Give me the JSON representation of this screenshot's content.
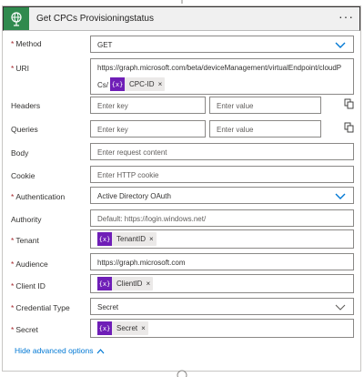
{
  "header": {
    "title": "Get CPCs Provisioningstatus",
    "menu_label": "···"
  },
  "fields": {
    "method": {
      "label": "Method",
      "required": true,
      "value": "GET"
    },
    "uri": {
      "label": "URI",
      "required": true,
      "value_line1": "https://graph.microsoft.com/beta/deviceManagement/virtualEndpoint/cloudP",
      "value_prefix": "Cs/",
      "token": "CPC-ID"
    },
    "headers": {
      "label": "Headers",
      "key_placeholder": "Enter key",
      "value_placeholder": "Enter value"
    },
    "queries": {
      "label": "Queries",
      "key_placeholder": "Enter key",
      "value_placeholder": "Enter value"
    },
    "body": {
      "label": "Body",
      "placeholder": "Enter request content"
    },
    "cookie": {
      "label": "Cookie",
      "placeholder": "Enter HTTP cookie"
    },
    "authentication": {
      "label": "Authentication",
      "required": true,
      "value": "Active Directory OAuth"
    },
    "authority": {
      "label": "Authority",
      "placeholder": "Default: https://login.windows.net/"
    },
    "tenant": {
      "label": "Tenant",
      "required": true,
      "token": "TenantID"
    },
    "audience": {
      "label": "Audience",
      "required": true,
      "value": "https://graph.microsoft.com"
    },
    "client_id": {
      "label": "Client ID",
      "required": true,
      "token": "ClientID"
    },
    "credential_type": {
      "label": "Credential Type",
      "required": true,
      "value": "Secret"
    },
    "secret": {
      "label": "Secret",
      "required": true,
      "token": "Secret"
    }
  },
  "token_icon_text": "{x}",
  "required_marker": "*",
  "remove_glyph": "×",
  "advanced_link": "Hide advanced options",
  "colors": {
    "accent": "#0078d4",
    "header_icon_bg": "#2f8a4e",
    "token_icon_bg": "#6f1eb7",
    "required": "#a4262c"
  }
}
